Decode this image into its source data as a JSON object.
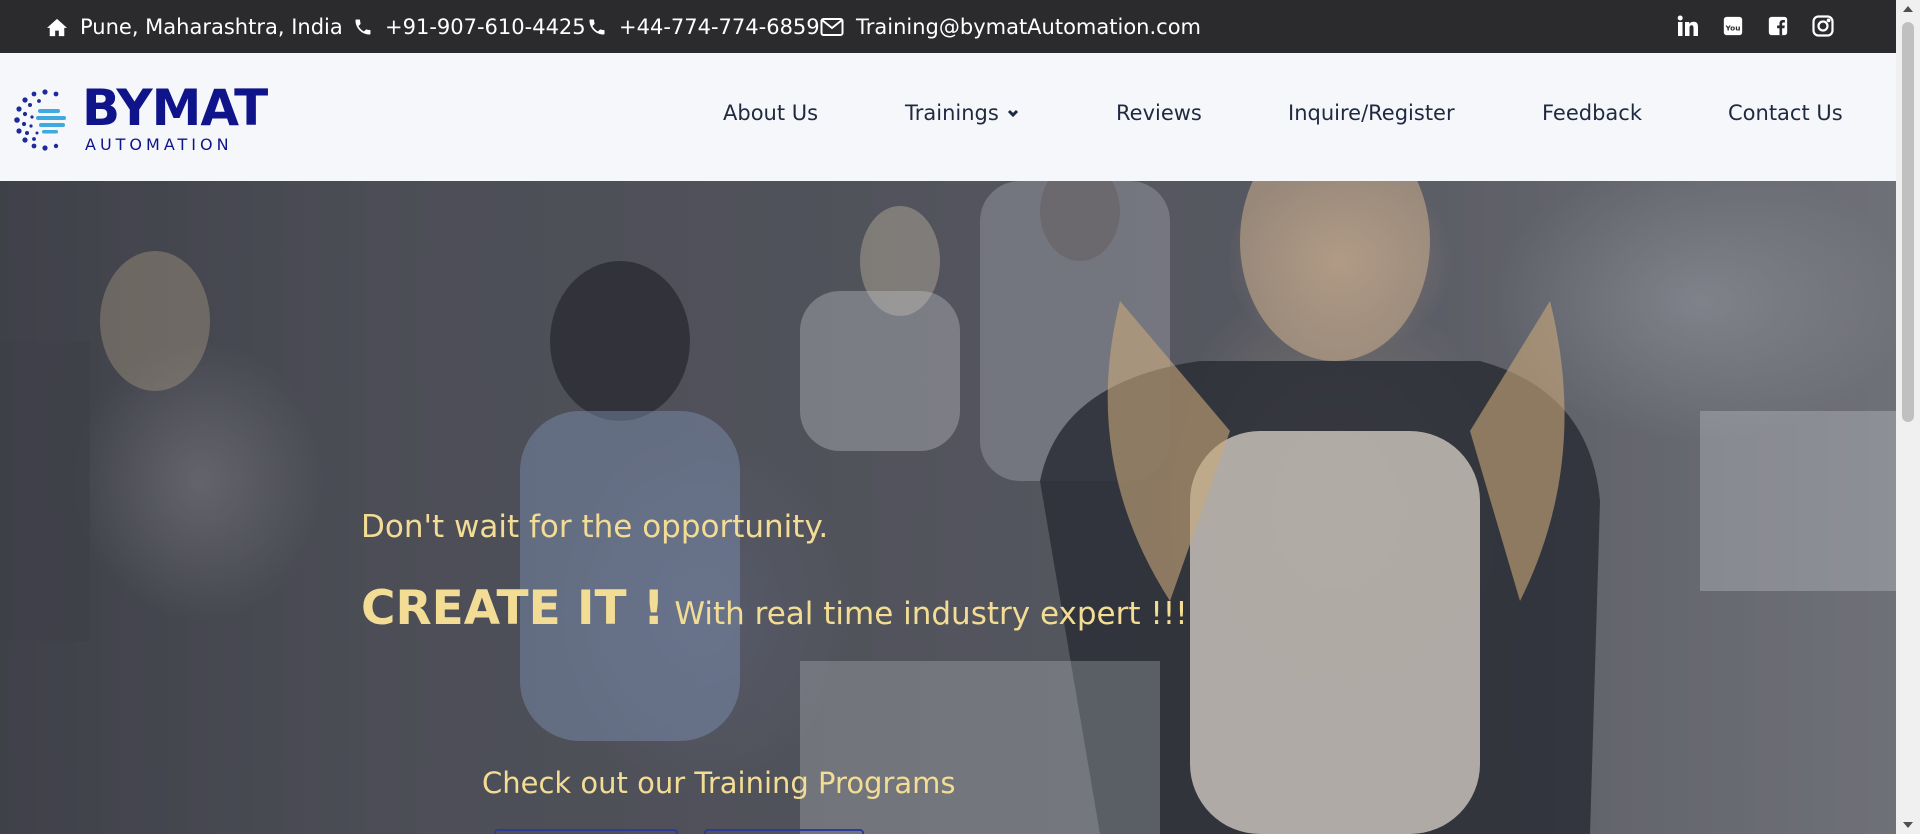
{
  "topbar": {
    "location": "Pune, Maharashtra, India",
    "phone1": "+91-907-610-4425",
    "phone2": "+44-774-774-6859",
    "email": "Training@bymatAutomation.com",
    "social": [
      "linkedin-icon",
      "youtube-icon",
      "facebook-icon",
      "instagram-icon"
    ]
  },
  "logo": {
    "word": "BYMAT",
    "sub": "AUTOMATION"
  },
  "nav": {
    "about": "About Us",
    "trainings": "Trainings",
    "reviews": "Reviews",
    "inquire": "Inquire/Register",
    "feedback": "Feedback",
    "contact": "Contact Us"
  },
  "hero": {
    "line1": "Don't wait for the opportunity.",
    "create": "CREATE IT !",
    "tagline": "With real time industry expert !!!",
    "cta": "Check out our Training Programs"
  },
  "colors": {
    "topbar_bg": "#2b2b2e",
    "nav_bg": "#f5f7fa",
    "brand": "#10148a",
    "hero_text": "#f3dd95"
  }
}
